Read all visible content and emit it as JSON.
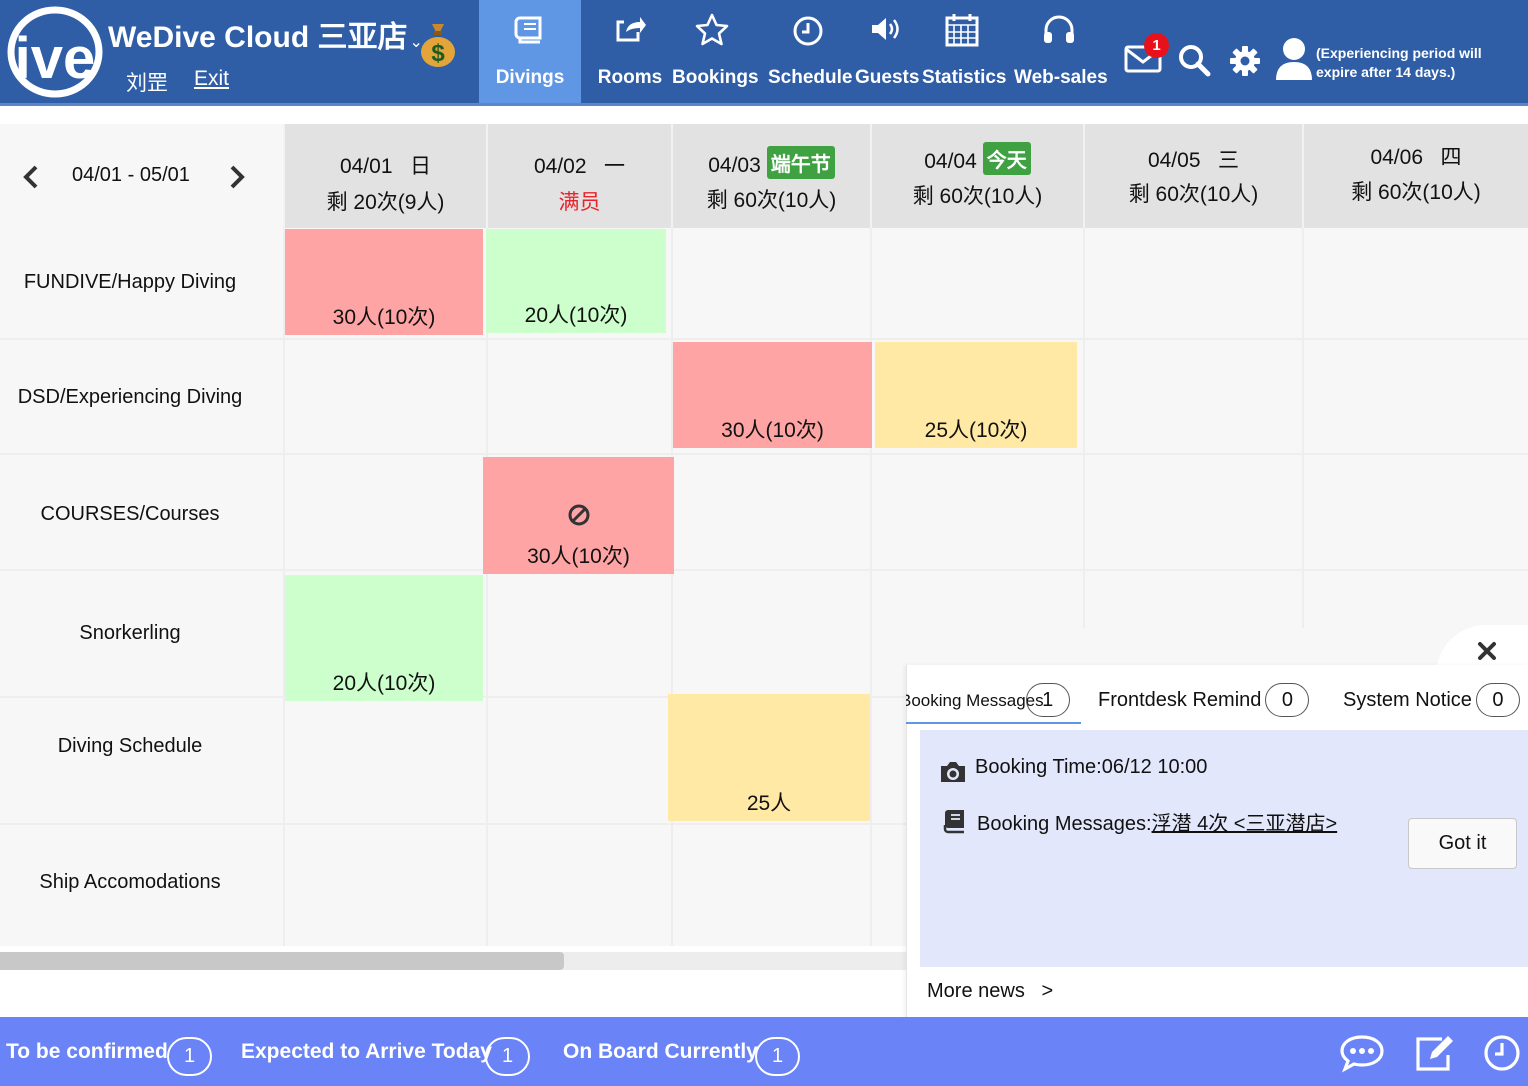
{
  "header": {
    "brand": "WeDive Cloud 三亚店",
    "brand_caret": "⌄",
    "user_name": "刘罡",
    "exit_label": "Exit",
    "nav": [
      {
        "label": "Divings",
        "icon": "book-icon",
        "active": true
      },
      {
        "label": "Rooms",
        "icon": "share-icon"
      },
      {
        "label": "Bookings",
        "icon": "star-icon"
      },
      {
        "label": "Schedule",
        "icon": "clock-icon"
      },
      {
        "label": "Guests",
        "icon": "speaker-icon"
      },
      {
        "label": "Statistics",
        "icon": "calendar-icon"
      },
      {
        "label": "Web-sales",
        "icon": "headphones-icon"
      }
    ],
    "mail_badge": "1",
    "trial_notice": "(Experiencing period will expire after 14 days.)"
  },
  "grid": {
    "date_range": "04/01 - 05/01",
    "columns": [
      {
        "date": "04/01",
        "weekday": "日",
        "remain": "剩 20次(9人)"
      },
      {
        "date": "04/02",
        "weekday": "一",
        "remain": "满员"
      },
      {
        "date": "04/03",
        "weekday": "",
        "tag": "端午节",
        "remain": "剩 60次(10人)"
      },
      {
        "date": "04/04",
        "weekday": "",
        "tag": "今天",
        "remain": "剩 60次(10人)"
      },
      {
        "date": "04/05",
        "weekday": "三",
        "remain": "剩 60次(10人)"
      },
      {
        "date": "04/06",
        "weekday": "四",
        "remain": "剩 60次(10人)"
      }
    ],
    "rows": [
      "FUNDIVE/Happy Diving",
      "DSD/Experiencing Diving",
      "COURSES/Courses",
      "Snorkerling",
      "Diving Schedule",
      "Ship Accomodations"
    ],
    "cells": {
      "r1c1": "30人(10次)",
      "r1c2": "20人(10次)",
      "r2c3": "30人(10次)",
      "r2c4": "25人(10次)",
      "r3c2": "30人(10次)",
      "r4c1": "20人(10次)",
      "r5c3": "25人"
    },
    "colors": {
      "red": "#ffa4a4",
      "green": "#ccffcc",
      "yellow": "#ffe9a4"
    }
  },
  "notifications": {
    "tabs": [
      {
        "label": "Booking Messages",
        "count": "1"
      },
      {
        "label": "Frontdesk Remind",
        "count": "0"
      },
      {
        "label": "System Notice",
        "count": "0"
      }
    ],
    "message": {
      "time_label": "Booking Time:06/12 10:00",
      "messages_prefix": "Booking Messages:",
      "messages_link": "浮潜 4次 <三亚潜店>"
    },
    "got_it": "Got it",
    "more_news": "More news",
    "more_arrow": ">"
  },
  "footer": {
    "stats": [
      {
        "label": "To be confirmed",
        "count": "1"
      },
      {
        "label": "Expected to Arrive Today",
        "count": "1"
      },
      {
        "label": "On Board Currently",
        "count": "1"
      }
    ]
  }
}
